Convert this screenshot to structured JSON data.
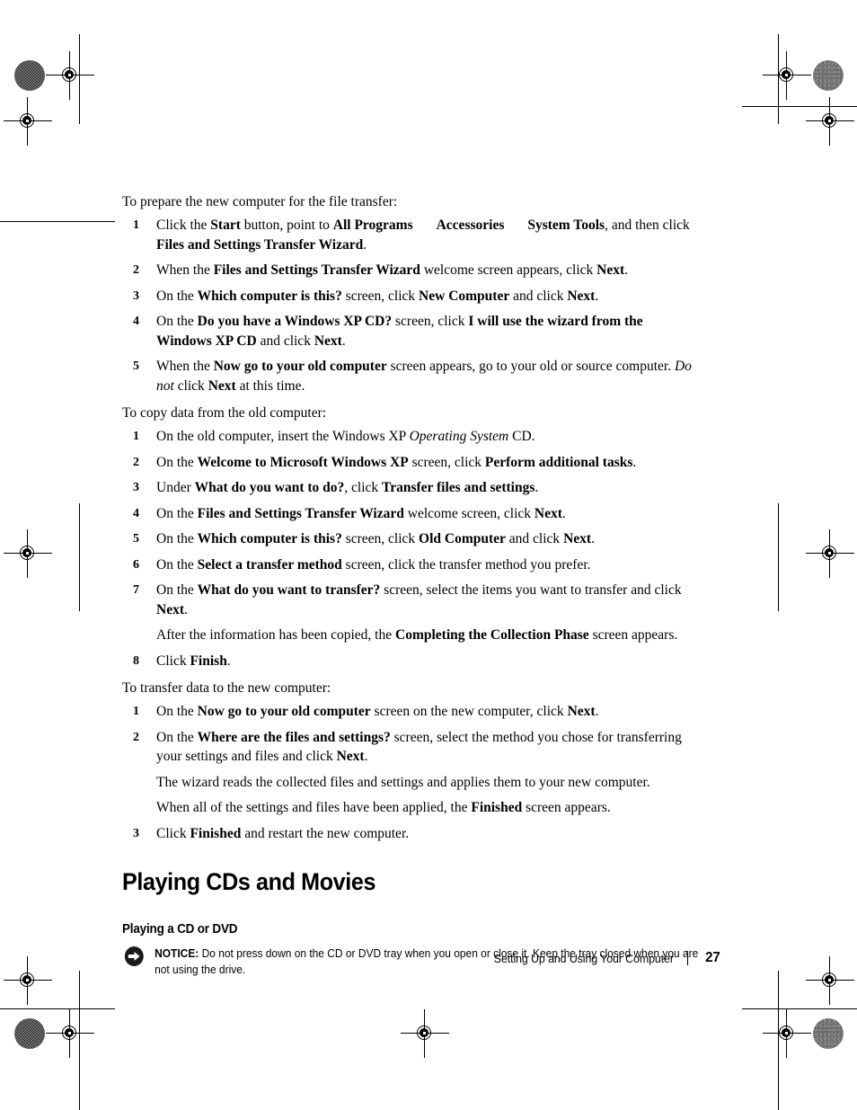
{
  "page": {
    "number": "27",
    "footer_title": "Setting Up and Using Your Computer",
    "footer_separator": "|"
  },
  "sections": {
    "prepare": {
      "lead": "To prepare the new computer for the file transfer:",
      "steps": [
        {
          "num": "1",
          "parts": [
            {
              "t": "Click the ",
              "s": "n"
            },
            {
              "t": "Start",
              "s": "b"
            },
            {
              "t": " button, point to ",
              "s": "n"
            },
            {
              "t": "All Programs",
              "s": "b"
            },
            {
              "t": "GAP",
              "s": "gap"
            },
            {
              "t": "Accessories",
              "s": "b"
            },
            {
              "t": "GAP",
              "s": "gap"
            },
            {
              "t": "System Tools",
              "s": "b"
            },
            {
              "t": ", and then click ",
              "s": "n"
            },
            {
              "t": "Files and Settings Transfer Wizard",
              "s": "b"
            },
            {
              "t": ".",
              "s": "n"
            }
          ]
        },
        {
          "num": "2",
          "parts": [
            {
              "t": "When the ",
              "s": "n"
            },
            {
              "t": "Files and Settings Transfer Wizard",
              "s": "b"
            },
            {
              "t": " welcome screen appears, click ",
              "s": "n"
            },
            {
              "t": "Next",
              "s": "b"
            },
            {
              "t": ".",
              "s": "n"
            }
          ]
        },
        {
          "num": "3",
          "parts": [
            {
              "t": "On the ",
              "s": "n"
            },
            {
              "t": "Which computer is this?",
              "s": "b"
            },
            {
              "t": " screen, click ",
              "s": "n"
            },
            {
              "t": "New Computer",
              "s": "b"
            },
            {
              "t": " and click ",
              "s": "n"
            },
            {
              "t": "Next",
              "s": "b"
            },
            {
              "t": ".",
              "s": "n"
            }
          ]
        },
        {
          "num": "4",
          "parts": [
            {
              "t": "On the ",
              "s": "n"
            },
            {
              "t": "Do you have a Windows XP CD?",
              "s": "b"
            },
            {
              "t": " screen, click ",
              "s": "n"
            },
            {
              "t": "I will use the wizard from the Windows XP CD",
              "s": "b"
            },
            {
              "t": " and click ",
              "s": "n"
            },
            {
              "t": "Next",
              "s": "b"
            },
            {
              "t": ".",
              "s": "n"
            }
          ]
        },
        {
          "num": "5",
          "parts": [
            {
              "t": "When the ",
              "s": "n"
            },
            {
              "t": "Now go to your old computer",
              "s": "b"
            },
            {
              "t": " screen appears, go to your old or source computer. ",
              "s": "n"
            },
            {
              "t": "Do not",
              "s": "i"
            },
            {
              "t": " click ",
              "s": "n"
            },
            {
              "t": "Next",
              "s": "b"
            },
            {
              "t": " at this time.",
              "s": "n"
            }
          ]
        }
      ]
    },
    "copy": {
      "lead": "To copy data from the old computer:",
      "steps": [
        {
          "num": "1",
          "parts": [
            {
              "t": "On the old computer, insert the Windows XP ",
              "s": "n"
            },
            {
              "t": "Operating System",
              "s": "i"
            },
            {
              "t": " CD.",
              "s": "n"
            }
          ]
        },
        {
          "num": "2",
          "parts": [
            {
              "t": "On the ",
              "s": "n"
            },
            {
              "t": "Welcome to Microsoft Windows XP",
              "s": "b"
            },
            {
              "t": " screen, click ",
              "s": "n"
            },
            {
              "t": "Perform additional tasks",
              "s": "b"
            },
            {
              "t": ".",
              "s": "n"
            }
          ]
        },
        {
          "num": "3",
          "parts": [
            {
              "t": "Under ",
              "s": "n"
            },
            {
              "t": "What do you want to do?",
              "s": "b"
            },
            {
              "t": ", click ",
              "s": "n"
            },
            {
              "t": "Transfer files and settings",
              "s": "b"
            },
            {
              "t": ".",
              "s": "n"
            }
          ]
        },
        {
          "num": "4",
          "parts": [
            {
              "t": "On the ",
              "s": "n"
            },
            {
              "t": "Files and Settings Transfer Wizard",
              "s": "b"
            },
            {
              "t": " welcome screen, click ",
              "s": "n"
            },
            {
              "t": "Next",
              "s": "b"
            },
            {
              "t": ".",
              "s": "n"
            }
          ]
        },
        {
          "num": "5",
          "parts": [
            {
              "t": "On the ",
              "s": "n"
            },
            {
              "t": "Which computer is this?",
              "s": "b"
            },
            {
              "t": " screen, click ",
              "s": "n"
            },
            {
              "t": "Old Computer",
              "s": "b"
            },
            {
              "t": " and click ",
              "s": "n"
            },
            {
              "t": "Next",
              "s": "b"
            },
            {
              "t": ".",
              "s": "n"
            }
          ]
        },
        {
          "num": "6",
          "parts": [
            {
              "t": "On the ",
              "s": "n"
            },
            {
              "t": "Select a transfer method",
              "s": "b"
            },
            {
              "t": " screen, click the transfer method you prefer.",
              "s": "n"
            }
          ]
        },
        {
          "num": "7",
          "parts": [
            {
              "t": "On the ",
              "s": "n"
            },
            {
              "t": "What do you want to transfer?",
              "s": "b"
            },
            {
              "t": " screen, select the items you want to transfer and click ",
              "s": "n"
            },
            {
              "t": "Next",
              "s": "b"
            },
            {
              "t": ".",
              "s": "n"
            }
          ],
          "follow": [
            [
              {
                "t": "After the information has been copied, the ",
                "s": "n"
              },
              {
                "t": "Completing the Collection Phase",
                "s": "b"
              },
              {
                "t": " screen appears.",
                "s": "n"
              }
            ]
          ]
        },
        {
          "num": "8",
          "parts": [
            {
              "t": "Click ",
              "s": "n"
            },
            {
              "t": "Finish",
              "s": "b"
            },
            {
              "t": ".",
              "s": "n"
            }
          ]
        }
      ]
    },
    "transfer": {
      "lead": "To transfer data to the new computer:",
      "steps": [
        {
          "num": "1",
          "parts": [
            {
              "t": "On the ",
              "s": "n"
            },
            {
              "t": "Now go to your old computer",
              "s": "b"
            },
            {
              "t": " screen on the new computer, click ",
              "s": "n"
            },
            {
              "t": "Next",
              "s": "b"
            },
            {
              "t": ".",
              "s": "n"
            }
          ]
        },
        {
          "num": "2",
          "parts": [
            {
              "t": "On the ",
              "s": "n"
            },
            {
              "t": "Where are the files and settings?",
              "s": "b"
            },
            {
              "t": " screen, select the method you chose for transferring your settings and files and click ",
              "s": "n"
            },
            {
              "t": "Next",
              "s": "b"
            },
            {
              "t": ".",
              "s": "n"
            }
          ],
          "follow": [
            [
              {
                "t": "The wizard reads the collected files and settings and applies them to your new computer.",
                "s": "n"
              }
            ],
            [
              {
                "t": "When all of the settings and files have been applied, the ",
                "s": "n"
              },
              {
                "t": "Finished",
                "s": "b"
              },
              {
                "t": " screen appears.",
                "s": "n"
              }
            ]
          ]
        },
        {
          "num": "3",
          "parts": [
            {
              "t": "Click ",
              "s": "n"
            },
            {
              "t": "Finished",
              "s": "b"
            },
            {
              "t": " and restart the new computer.",
              "s": "n"
            }
          ]
        }
      ]
    }
  },
  "headings": {
    "section_title": "Playing CDs and Movies",
    "subsection_title": "Playing a CD or DVD"
  },
  "notice": {
    "icon": "notice-arrow-icon",
    "label": "NOTICE:",
    "text": " Do not press down on the CD or DVD tray when you open or close it. Keep the tray closed when you are not using the drive."
  }
}
